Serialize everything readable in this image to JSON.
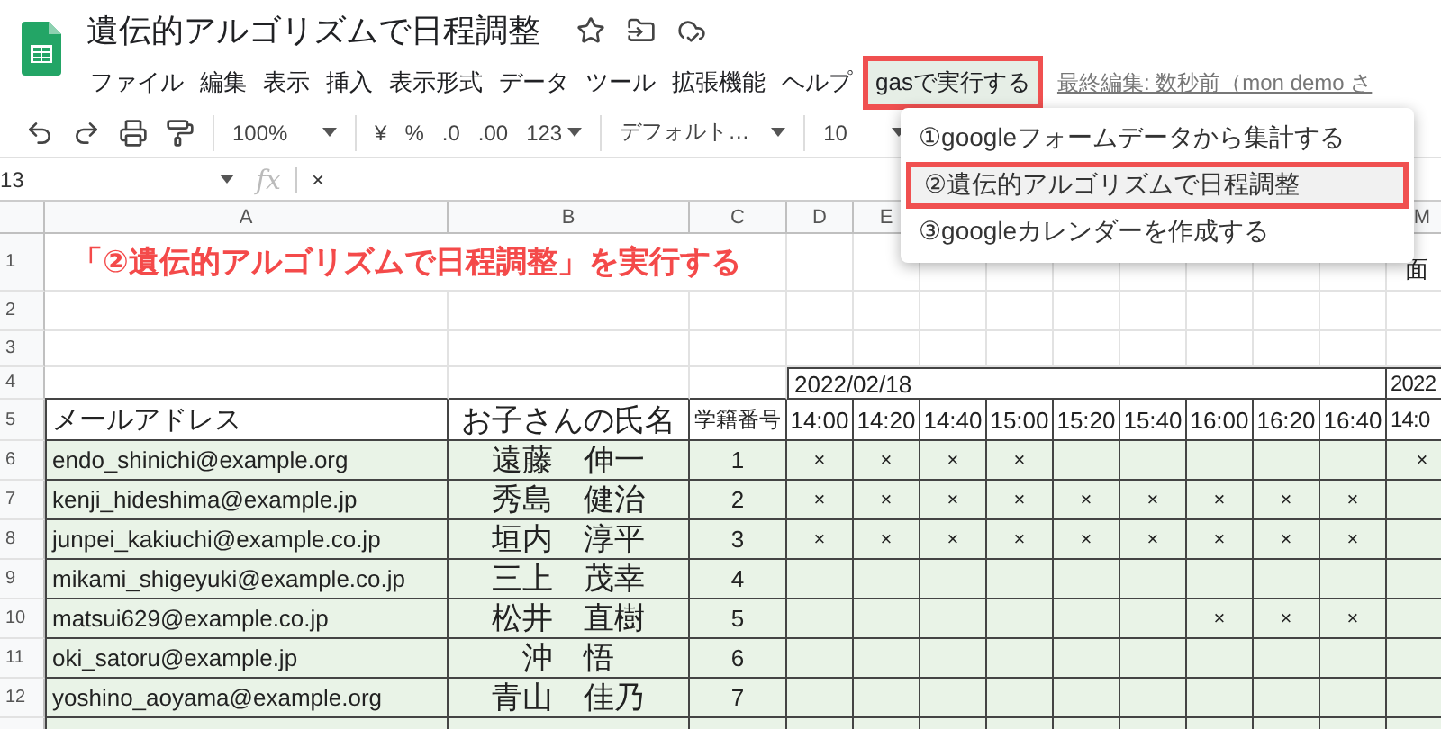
{
  "app": {
    "title": "遺伝的アルゴリズムで日程調整",
    "last_edit": "最終編集: 数秒前（mon demo さ",
    "menu": [
      {
        "label": "ファイル",
        "selected": false
      },
      {
        "label": "編集",
        "selected": false
      },
      {
        "label": "表示",
        "selected": false
      },
      {
        "label": "挿入",
        "selected": false
      },
      {
        "label": "表示形式",
        "selected": false
      },
      {
        "label": "データ",
        "selected": false
      },
      {
        "label": "ツール",
        "selected": false
      },
      {
        "label": "拡張機能",
        "selected": false
      },
      {
        "label": "ヘルプ",
        "selected": false
      },
      {
        "label": "gasで実行する",
        "selected": true
      }
    ]
  },
  "toolbar": {
    "zoom": "100%",
    "currency": "¥",
    "percent": "%",
    "decrease_decimals": ".0",
    "increase_decimals": ".00",
    "number_format": "123",
    "font": "デフォルト…",
    "font_size": "10"
  },
  "formula_bar": {
    "cell": "13",
    "function_label": "fx",
    "value": "×"
  },
  "dropdown": {
    "items": [
      {
        "label": "①googleフォームデータから集計する",
        "selected": false
      },
      {
        "label": "②遺伝的アルゴリズムで日程調整",
        "selected": true
      },
      {
        "label": "③googleカレンダーを作成する",
        "selected": false
      }
    ]
  },
  "sheet": {
    "columns": [
      "A",
      "B",
      "C",
      "D",
      "E",
      "M"
    ],
    "row_numbers": [
      "1",
      "2",
      "3",
      "4",
      "5",
      "6",
      "7",
      "8",
      "9",
      "10",
      "11",
      "12"
    ],
    "banner": "「②遺伝的アルゴリズムで日程調整」を実行する",
    "corner_note": "面",
    "date": "2022/02/18",
    "next_date": "2022",
    "headers": [
      "メールアドレス",
      "お子さんの氏名",
      "学籍番号"
    ],
    "times": [
      "14:00",
      "14:20",
      "14:40",
      "15:00",
      "15:20",
      "15:40",
      "16:00",
      "16:20",
      "16:40"
    ],
    "next_time": "14:0",
    "students": [
      {
        "email": "endo_shinichi@example.org",
        "name": "遠藤　伸一",
        "id": "1",
        "slots": {
          "d": "×",
          "e": "×",
          "f": "×",
          "g": "×",
          "m": "×"
        }
      },
      {
        "email": "kenji_hideshima@example.jp",
        "name": "秀島　健治",
        "id": "2",
        "slots": {
          "d": "×",
          "e": "×",
          "f": "×",
          "g": "×",
          "h": "×",
          "i": "×",
          "j": "×",
          "k": "×",
          "l": "×"
        }
      },
      {
        "email": "junpei_kakiuchi@example.co.jp",
        "name": "垣内　淳平",
        "id": "3",
        "slots": {
          "d": "×",
          "e": "×",
          "f": "×",
          "g": "×",
          "h": "×",
          "i": "×",
          "j": "×",
          "k": "×",
          "l": "×"
        }
      },
      {
        "email": "mikami_shigeyuki@example.co.jp",
        "name": "三上　茂幸",
        "id": "4"
      },
      {
        "email": "matsui629@example.co.jp",
        "name": "松井　直樹",
        "id": "5",
        "slots": {
          "j": "×",
          "k": "×",
          "l": "×"
        }
      },
      {
        "email": "oki_satoru@example.jp",
        "name": "沖　悟",
        "id": "6"
      },
      {
        "email": "yoshino_aoyama@example.org",
        "name": "青山　佳乃",
        "id": "7"
      }
    ]
  }
}
